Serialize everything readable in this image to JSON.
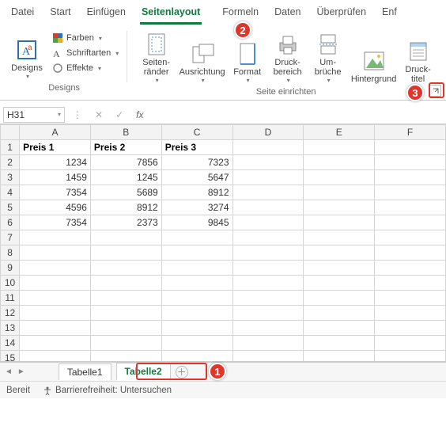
{
  "ribbon": {
    "tabs": [
      "Datei",
      "Start",
      "Einfügen",
      "Seitenlayout",
      "Formeln",
      "Daten",
      "Überprüfen",
      "Enf"
    ],
    "active_tab": "Seitenlayout",
    "designs_group": {
      "label": "Designs",
      "big": "Designs",
      "items": [
        "Farben",
        "Schriftarten",
        "Effekte"
      ]
    },
    "page_setup_group": {
      "label": "Seite einrichten",
      "buttons": {
        "margins": "Seiten-\nränder",
        "orientation": "Ausrichtung",
        "size": "Format",
        "print_area": "Druck-\nbereich",
        "breaks": "Um-\nbrüche",
        "background": "Hintergrund",
        "print_titles": "Druck-\ntitel"
      }
    }
  },
  "annotations": {
    "a1": "1",
    "a2": "2",
    "a3": "3"
  },
  "namebox": "H31",
  "columns": [
    "A",
    "B",
    "C",
    "D",
    "E",
    "F"
  ],
  "headers": [
    "Preis 1",
    "Preis 2",
    "Preis 3"
  ],
  "rows": [
    [
      "1234",
      "7856",
      "7323"
    ],
    [
      "1459",
      "1245",
      "5647"
    ],
    [
      "7354",
      "5689",
      "8912"
    ],
    [
      "4596",
      "8912",
      "3274"
    ],
    [
      "7354",
      "2373",
      "9845"
    ]
  ],
  "sheet_tabs": {
    "t1": "Tabelle1",
    "t2": "Tabelle2"
  },
  "status": {
    "ready": "Bereit",
    "accessibility": "Barrierefreiheit: Untersuchen"
  }
}
